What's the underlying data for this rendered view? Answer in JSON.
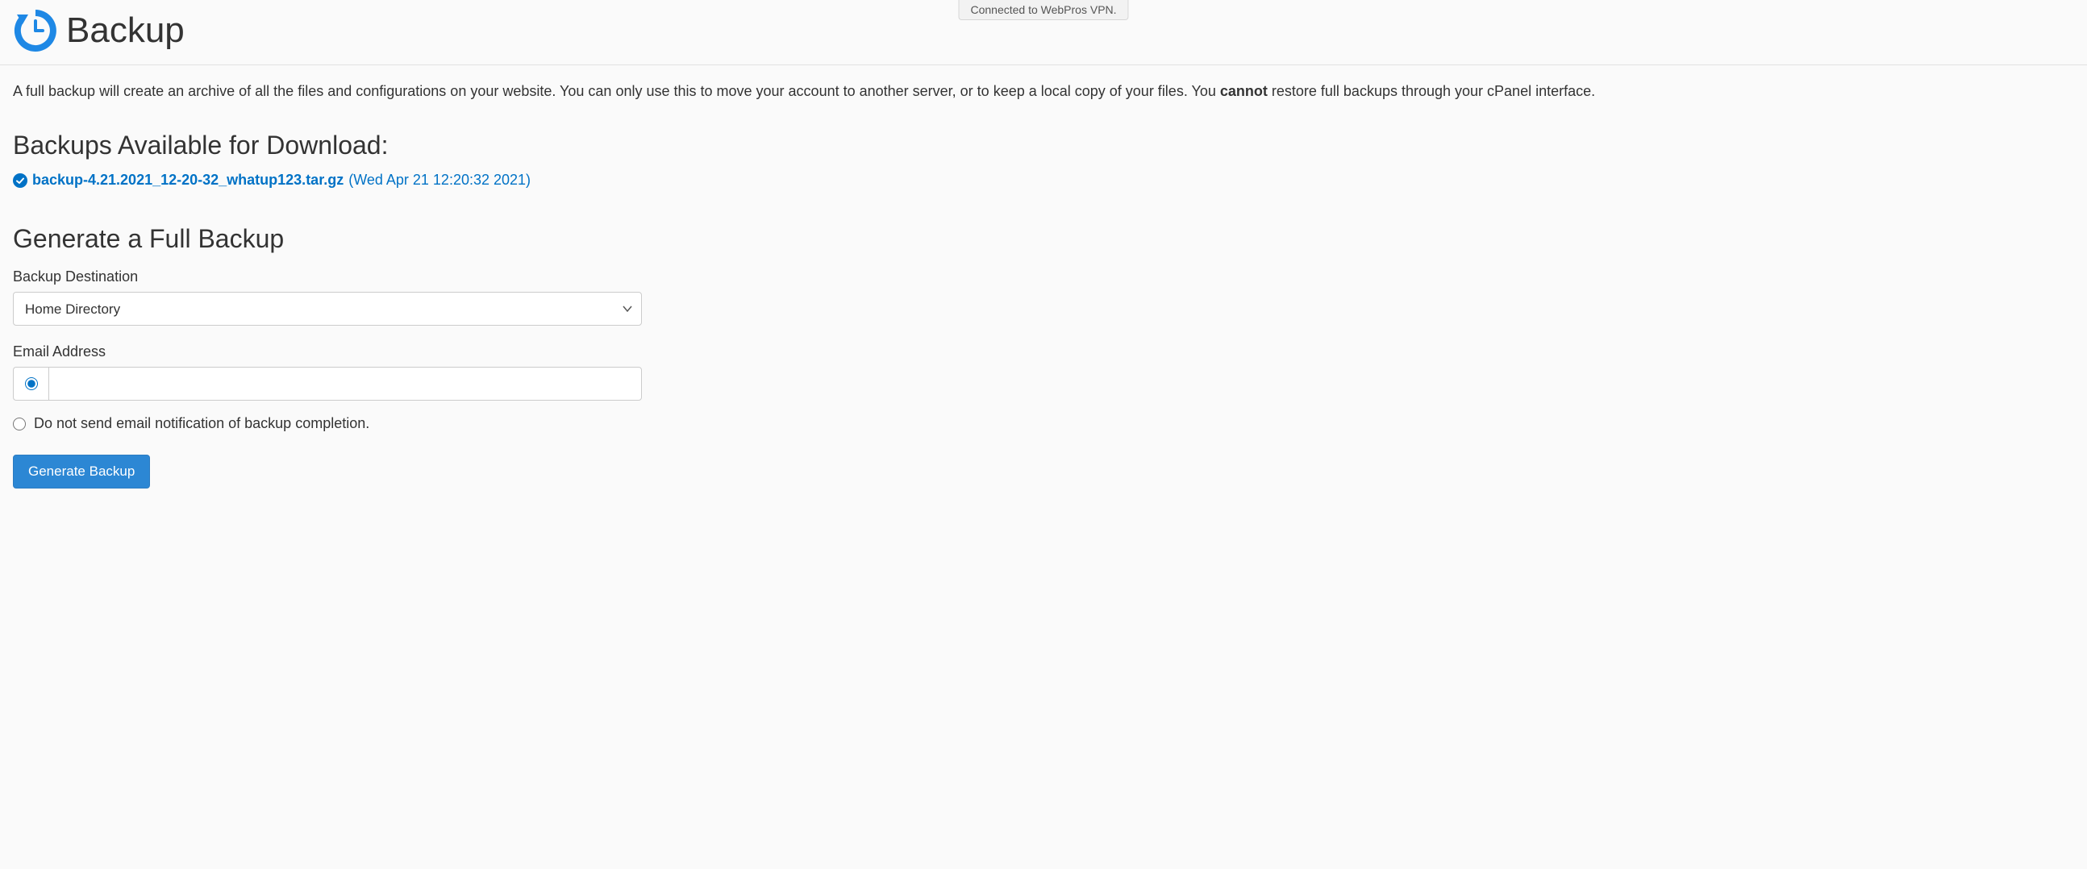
{
  "vpn_status": "Connected to WebPros VPN.",
  "page_title": "Backup",
  "description": {
    "pre": "A full backup will create an archive of all the files and configurations on your website. You can only use this to move your account to another server, or to keep a local copy of your files. You ",
    "strong": "cannot",
    "post": " restore full backups through your cPanel interface."
  },
  "available_heading": "Backups Available for Download:",
  "available_backup": {
    "filename": "backup-4.21.2021_12-20-32_whatup123.tar.gz",
    "date": "(Wed Apr 21 12:20:32 2021)"
  },
  "generate_heading": "Generate a Full Backup",
  "form": {
    "destination_label": "Backup Destination",
    "destination_value": "Home Directory",
    "email_label": "Email Address",
    "email_value": "",
    "no_email_label": "Do not send email notification of backup completion.",
    "submit_label": "Generate Backup"
  },
  "colors": {
    "accent": "#1e88e5",
    "link": "#0072c6",
    "button": "#2c87d4"
  }
}
